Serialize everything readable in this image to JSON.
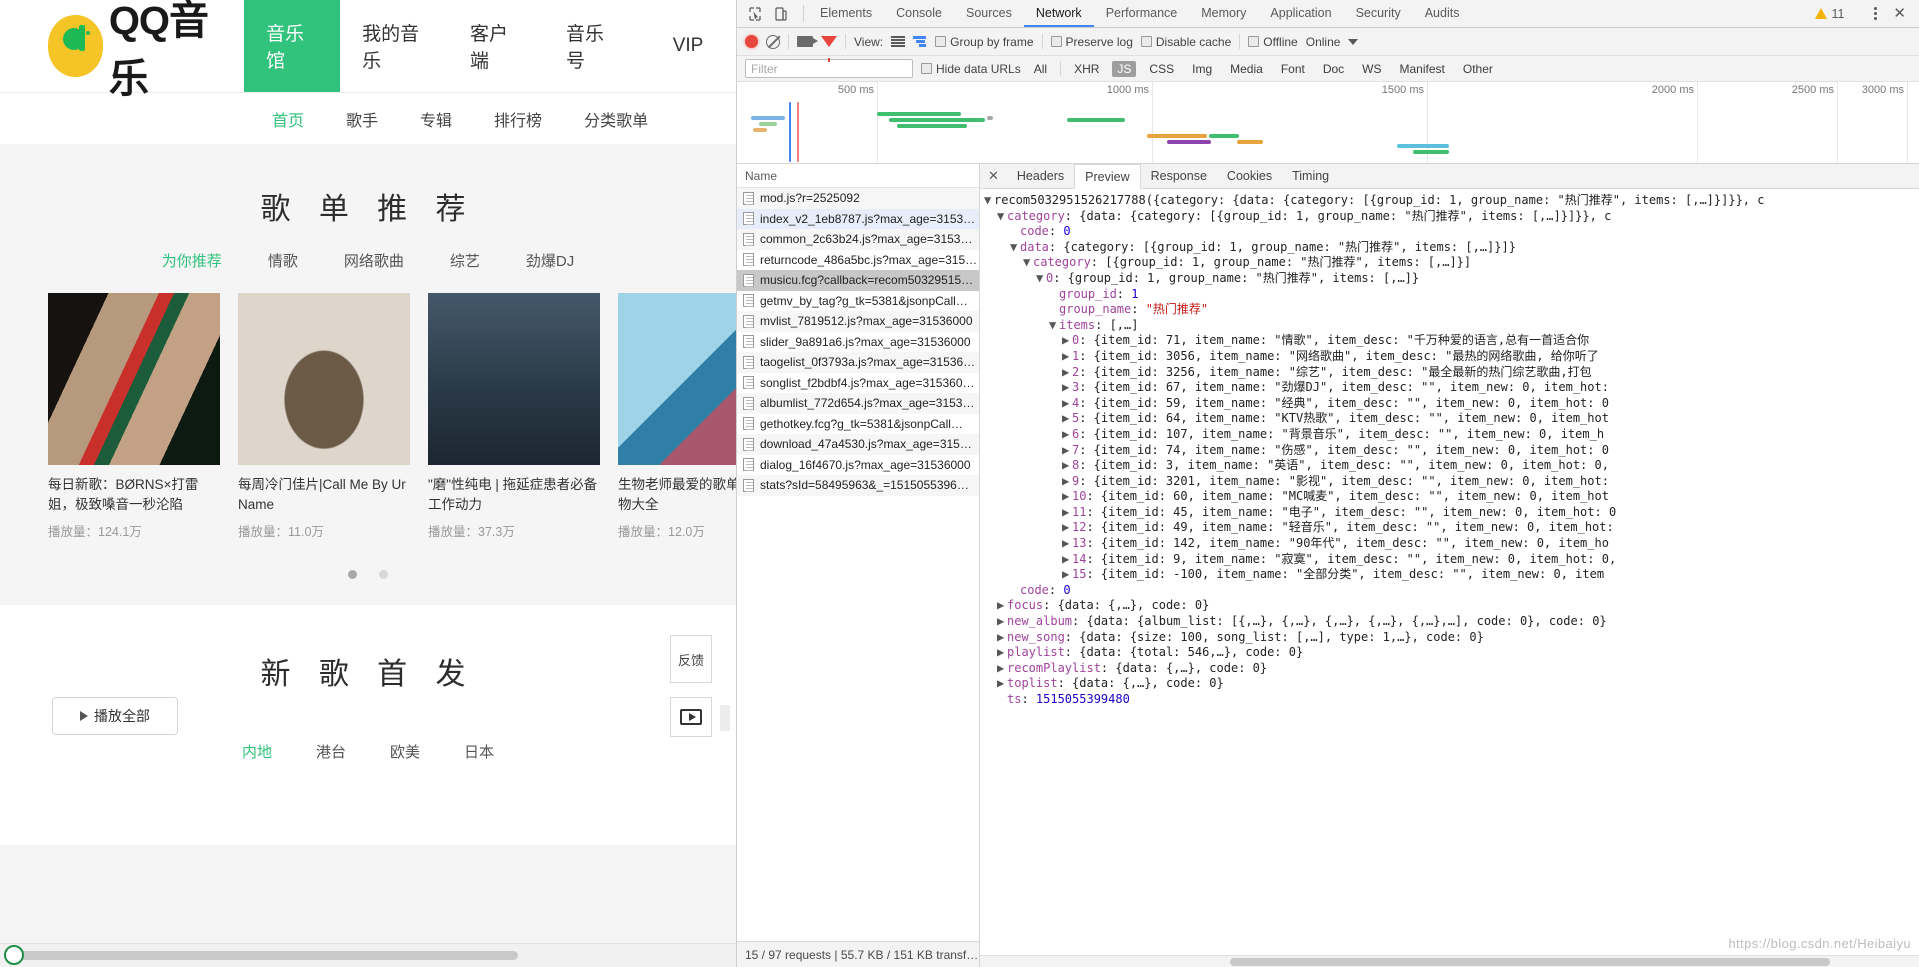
{
  "site": {
    "brand": "QQ音乐",
    "nav": [
      {
        "label": "音乐馆",
        "active": true
      },
      {
        "label": "我的音乐",
        "active": false
      },
      {
        "label": "客户端",
        "active": false
      },
      {
        "label": "音乐号",
        "active": false
      },
      {
        "label": "VIP",
        "active": false
      }
    ],
    "subnav": [
      {
        "label": "首页",
        "active": true
      },
      {
        "label": "歌手",
        "active": false
      },
      {
        "label": "专辑",
        "active": false
      },
      {
        "label": "排行榜",
        "active": false
      },
      {
        "label": "分类歌单",
        "active": false
      }
    ],
    "playlist_section": {
      "title": "歌 单 推 荐",
      "tabs": [
        {
          "label": "为你推荐",
          "active": true
        },
        {
          "label": "情歌",
          "active": false
        },
        {
          "label": "网络歌曲",
          "active": false
        },
        {
          "label": "综艺",
          "active": false
        },
        {
          "label": "劲爆DJ",
          "active": false
        }
      ],
      "cards": [
        {
          "title": "每日新歌：BØRNS×打雷姐，极致嗓音一秒沦陷",
          "plays": "播放量：124.1万"
        },
        {
          "title": "每周冷门佳片|Call Me By Ur Name",
          "plays": "播放量：11.0万"
        },
        {
          "title": "\"磨\"性纯电 | 拖延症患者必备工作动力",
          "plays": "播放量：37.3万"
        },
        {
          "title": "生物老师最爱的歌单直是动物大全",
          "plays": "播放量：12.0万"
        }
      ]
    },
    "newsong_section": {
      "title": "新 歌 首 发",
      "play_all": "播放全部",
      "tabs": [
        {
          "label": "内地",
          "active": true
        },
        {
          "label": "港台",
          "active": false
        },
        {
          "label": "欧美",
          "active": false
        },
        {
          "label": "日本",
          "active": false
        }
      ],
      "feedback": "反馈"
    }
  },
  "devtools": {
    "tabs": [
      {
        "label": "Elements",
        "active": false
      },
      {
        "label": "Console",
        "active": false
      },
      {
        "label": "Sources",
        "active": false
      },
      {
        "label": "Network",
        "active": true
      },
      {
        "label": "Performance",
        "active": false
      },
      {
        "label": "Memory",
        "active": false
      },
      {
        "label": "Application",
        "active": false
      },
      {
        "label": "Security",
        "active": false
      },
      {
        "label": "Audits",
        "active": false
      }
    ],
    "warning_count": "11",
    "toolbar": {
      "view_label": "View:",
      "group_by_frame": "Group by frame",
      "preserve_log": "Preserve log",
      "disable_cache": "Disable cache",
      "offline": "Offline",
      "throttling": "Online"
    },
    "filterbar": {
      "filter_placeholder": "Filter",
      "filter_value": "",
      "hide_data_urls": "Hide data URLs",
      "types": [
        {
          "label": "All",
          "active": false
        },
        {
          "label": "XHR",
          "active": false
        },
        {
          "label": "JS",
          "active": true
        },
        {
          "label": "CSS",
          "active": false
        },
        {
          "label": "Img",
          "active": false
        },
        {
          "label": "Media",
          "active": false
        },
        {
          "label": "Font",
          "active": false
        },
        {
          "label": "Doc",
          "active": false
        },
        {
          "label": "WS",
          "active": false
        },
        {
          "label": "Manifest",
          "active": false
        },
        {
          "label": "Other",
          "active": false
        }
      ]
    },
    "overview_ticks": [
      "500 ms",
      "1000 ms",
      "1500 ms",
      "2000 ms",
      "2500 ms",
      "3000 ms"
    ],
    "requests": {
      "column_header": "Name",
      "rows": [
        {
          "name": "mod.js?r=2525092",
          "state": "normal"
        },
        {
          "name": "index_v2_1eb8787.js?max_age=3153…",
          "state": "highlight"
        },
        {
          "name": "common_2c63b24.js?max_age=3153…",
          "state": "normal"
        },
        {
          "name": "returncode_486a5bc.js?max_age=315…",
          "state": "normal"
        },
        {
          "name": "musicu.fcg?callback=recom50329515…",
          "state": "selected"
        },
        {
          "name": "getmv_by_tag?g_tk=5381&jsonpCall…",
          "state": "normal"
        },
        {
          "name": "mvlist_7819512.js?max_age=31536000",
          "state": "normal"
        },
        {
          "name": "slider_9a891a6.js?max_age=31536000",
          "state": "normal"
        },
        {
          "name": "taogelist_0f3793a.js?max_age=31536…",
          "state": "normal"
        },
        {
          "name": "songlist_f2bdbf4.js?max_age=315360…",
          "state": "normal"
        },
        {
          "name": "albumlist_772d654.js?max_age=3153…",
          "state": "normal"
        },
        {
          "name": "gethotkey.fcg?g_tk=5381&jsonpCall…",
          "state": "normal"
        },
        {
          "name": "download_47a4530.js?max_age=315…",
          "state": "normal"
        },
        {
          "name": "dialog_16f4670.js?max_age=31536000",
          "state": "normal"
        },
        {
          "name": "stats?sId=58495963&_=1515055396…",
          "state": "normal"
        }
      ],
      "status": "15 / 97 requests  |  55.7 KB / 151 KB transf…"
    },
    "detail_tabs": [
      {
        "label": "Headers",
        "active": false
      },
      {
        "label": "Preview",
        "active": true
      },
      {
        "label": "Response",
        "active": false
      },
      {
        "label": "Cookies",
        "active": false
      },
      {
        "label": "Timing",
        "active": false
      }
    ],
    "preview_lines": [
      {
        "indent": 0,
        "arrow": "open",
        "parts": [
          {
            "t": "plain",
            "v": "recom5032951526217788({category: {data: {category: [{group_id: 1, group_name: \"热门推荐\", items: [,…]}]}}, c"
          }
        ]
      },
      {
        "indent": 1,
        "arrow": "open",
        "parts": [
          {
            "t": "k",
            "v": "category"
          },
          {
            "t": "plain",
            "v": ": {data: {category: [{group_id: 1, group_name: \"热门推荐\", items: [,…]}]}}, c"
          }
        ]
      },
      {
        "indent": 2,
        "arrow": "none",
        "parts": [
          {
            "t": "k",
            "v": "code"
          },
          {
            "t": "plain",
            "v": ": "
          },
          {
            "t": "num",
            "v": "0"
          }
        ]
      },
      {
        "indent": 2,
        "arrow": "open",
        "parts": [
          {
            "t": "k",
            "v": "data"
          },
          {
            "t": "plain",
            "v": ": {category: [{group_id: 1, group_name: \"热门推荐\", items: [,…]}]}"
          }
        ]
      },
      {
        "indent": 3,
        "arrow": "open",
        "parts": [
          {
            "t": "k",
            "v": "category"
          },
          {
            "t": "plain",
            "v": ": [{group_id: 1, group_name: \"热门推荐\", items: [,…]}]"
          }
        ]
      },
      {
        "indent": 4,
        "arrow": "open",
        "parts": [
          {
            "t": "k",
            "v": "0"
          },
          {
            "t": "plain",
            "v": ": {group_id: 1, group_name: \"热门推荐\", items: [,…]}"
          }
        ]
      },
      {
        "indent": 5,
        "arrow": "none",
        "parts": [
          {
            "t": "k",
            "v": "group_id"
          },
          {
            "t": "plain",
            "v": ": "
          },
          {
            "t": "num",
            "v": "1"
          }
        ]
      },
      {
        "indent": 5,
        "arrow": "none",
        "parts": [
          {
            "t": "k",
            "v": "group_name"
          },
          {
            "t": "plain",
            "v": ": "
          },
          {
            "t": "str",
            "v": "\"热门推荐\""
          }
        ]
      },
      {
        "indent": 5,
        "arrow": "open",
        "parts": [
          {
            "t": "k",
            "v": "items"
          },
          {
            "t": "plain",
            "v": ": [,…]"
          }
        ]
      },
      {
        "indent": 6,
        "arrow": "closed",
        "parts": [
          {
            "t": "k",
            "v": "0"
          },
          {
            "t": "plain",
            "v": ": {item_id: 71, item_name: \"情歌\", item_desc: \"千万种爱的语言,总有一首适合你"
          }
        ]
      },
      {
        "indent": 6,
        "arrow": "closed",
        "parts": [
          {
            "t": "k",
            "v": "1"
          },
          {
            "t": "plain",
            "v": ": {item_id: 3056, item_name: \"网络歌曲\", item_desc: \"最热的网络歌曲, 给你听了"
          }
        ]
      },
      {
        "indent": 6,
        "arrow": "closed",
        "parts": [
          {
            "t": "k",
            "v": "2"
          },
          {
            "t": "plain",
            "v": ": {item_id: 3256, item_name: \"综艺\", item_desc: \"最全最新的热门综艺歌曲,打包"
          }
        ]
      },
      {
        "indent": 6,
        "arrow": "closed",
        "parts": [
          {
            "t": "k",
            "v": "3"
          },
          {
            "t": "plain",
            "v": ": {item_id: 67, item_name: \"劲爆DJ\", item_desc: \"\", item_new: 0, item_hot:"
          }
        ]
      },
      {
        "indent": 6,
        "arrow": "closed",
        "parts": [
          {
            "t": "k",
            "v": "4"
          },
          {
            "t": "plain",
            "v": ": {item_id: 59, item_name: \"经典\", item_desc: \"\", item_new: 0, item_hot: 0"
          }
        ]
      },
      {
        "indent": 6,
        "arrow": "closed",
        "parts": [
          {
            "t": "k",
            "v": "5"
          },
          {
            "t": "plain",
            "v": ": {item_id: 64, item_name: \"KTV热歌\", item_desc: \"\", item_new: 0, item_hot"
          }
        ]
      },
      {
        "indent": 6,
        "arrow": "closed",
        "parts": [
          {
            "t": "k",
            "v": "6"
          },
          {
            "t": "plain",
            "v": ": {item_id: 107, item_name: \"背景音乐\", item_desc: \"\", item_new: 0, item_h"
          }
        ]
      },
      {
        "indent": 6,
        "arrow": "closed",
        "parts": [
          {
            "t": "k",
            "v": "7"
          },
          {
            "t": "plain",
            "v": ": {item_id: 74, item_name: \"伤感\", item_desc: \"\", item_new: 0, item_hot: 0"
          }
        ]
      },
      {
        "indent": 6,
        "arrow": "closed",
        "parts": [
          {
            "t": "k",
            "v": "8"
          },
          {
            "t": "plain",
            "v": ": {item_id: 3, item_name: \"英语\", item_desc: \"\", item_new: 0, item_hot: 0,"
          }
        ]
      },
      {
        "indent": 6,
        "arrow": "closed",
        "parts": [
          {
            "t": "k",
            "v": "9"
          },
          {
            "t": "plain",
            "v": ": {item_id: 3201, item_name: \"影视\", item_desc: \"\", item_new: 0, item_hot:"
          }
        ]
      },
      {
        "indent": 6,
        "arrow": "closed",
        "parts": [
          {
            "t": "k",
            "v": "10"
          },
          {
            "t": "plain",
            "v": ": {item_id: 60, item_name: \"MC喊麦\", item_desc: \"\", item_new: 0, item_hot"
          }
        ]
      },
      {
        "indent": 6,
        "arrow": "closed",
        "parts": [
          {
            "t": "k",
            "v": "11"
          },
          {
            "t": "plain",
            "v": ": {item_id: 45, item_name: \"电子\", item_desc: \"\", item_new: 0, item_hot: 0"
          }
        ]
      },
      {
        "indent": 6,
        "arrow": "closed",
        "parts": [
          {
            "t": "k",
            "v": "12"
          },
          {
            "t": "plain",
            "v": ": {item_id: 49, item_name: \"轻音乐\", item_desc: \"\", item_new: 0, item_hot:"
          }
        ]
      },
      {
        "indent": 6,
        "arrow": "closed",
        "parts": [
          {
            "t": "k",
            "v": "13"
          },
          {
            "t": "plain",
            "v": ": {item_id: 142, item_name: \"90年代\", item_desc: \"\", item_new: 0, item_ho"
          }
        ]
      },
      {
        "indent": 6,
        "arrow": "closed",
        "parts": [
          {
            "t": "k",
            "v": "14"
          },
          {
            "t": "plain",
            "v": ": {item_id: 9, item_name: \"寂寞\", item_desc: \"\", item_new: 0, item_hot: 0,"
          }
        ]
      },
      {
        "indent": 6,
        "arrow": "closed",
        "parts": [
          {
            "t": "k",
            "v": "15"
          },
          {
            "t": "plain",
            "v": ": {item_id: -100, item_name: \"全部分类\", item_desc: \"\", item_new: 0, item"
          }
        ]
      },
      {
        "indent": 2,
        "arrow": "none",
        "parts": [
          {
            "t": "k",
            "v": "code"
          },
          {
            "t": "plain",
            "v": ": "
          },
          {
            "t": "num",
            "v": "0"
          }
        ]
      },
      {
        "indent": 1,
        "arrow": "closed",
        "parts": [
          {
            "t": "k",
            "v": "focus"
          },
          {
            "t": "plain",
            "v": ": {data: {,…}, code: 0}"
          }
        ]
      },
      {
        "indent": 1,
        "arrow": "closed",
        "parts": [
          {
            "t": "k",
            "v": "new_album"
          },
          {
            "t": "plain",
            "v": ": {data: {album_list: [{,…}, {,…}, {,…}, {,…}, {,…},…], code: 0}, code: 0}"
          }
        ]
      },
      {
        "indent": 1,
        "arrow": "closed",
        "parts": [
          {
            "t": "k",
            "v": "new_song"
          },
          {
            "t": "plain",
            "v": ": {data: {size: 100, song_list: [,…], type: 1,…}, code: 0}"
          }
        ]
      },
      {
        "indent": 1,
        "arrow": "closed",
        "parts": [
          {
            "t": "k",
            "v": "playlist"
          },
          {
            "t": "plain",
            "v": ": {data: {total: 546,…}, code: 0}"
          }
        ]
      },
      {
        "indent": 1,
        "arrow": "closed",
        "parts": [
          {
            "t": "k",
            "v": "recomPlaylist"
          },
          {
            "t": "plain",
            "v": ": {data: {,…}, code: 0}"
          }
        ]
      },
      {
        "indent": 1,
        "arrow": "closed",
        "parts": [
          {
            "t": "k",
            "v": "toplist"
          },
          {
            "t": "plain",
            "v": ": {data: {,…}, code: 0}"
          }
        ]
      },
      {
        "indent": 1,
        "arrow": "none",
        "parts": [
          {
            "t": "k",
            "v": "ts"
          },
          {
            "t": "plain",
            "v": ": "
          },
          {
            "t": "num",
            "v": "1515055399480"
          }
        ]
      }
    ],
    "watermark": "https://blog.csdn.net/Heibaiyu"
  }
}
